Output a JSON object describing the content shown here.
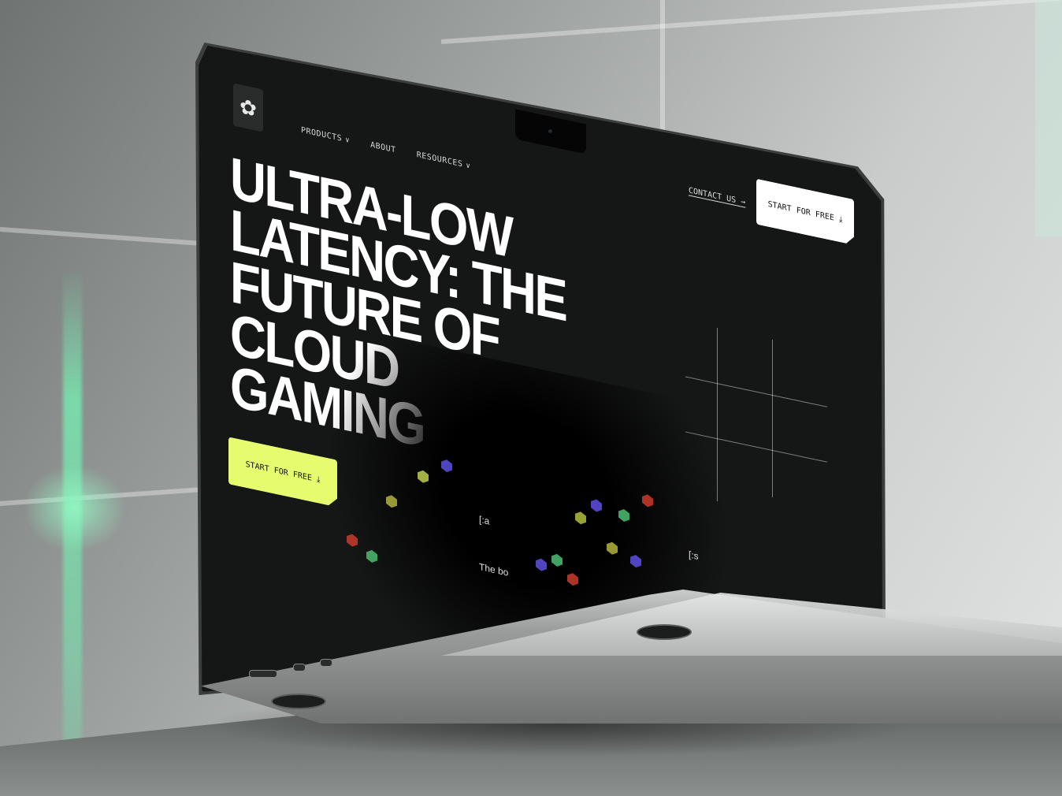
{
  "nav": {
    "items": [
      {
        "label": "PRODUCTS",
        "has_dropdown": true
      },
      {
        "label": "ABOUT",
        "has_dropdown": false
      },
      {
        "label": "RESOURCES",
        "has_dropdown": true
      }
    ]
  },
  "header": {
    "contact_label": "CONTACT US",
    "cta_label": "START FOR FREE"
  },
  "hero": {
    "title_lines": [
      "ULTRA-LOW",
      "LATENCY: THE",
      "FUTURE OF CLOUD",
      "GAMING"
    ],
    "cta_label": "START FOR FREE"
  },
  "content": {
    "fragment_1": "[:a",
    "fragment_2": "The bo",
    "fragment_3": "[:s"
  },
  "colors": {
    "accent_yellow": "#e6fb6e",
    "background": "#111111",
    "text": "#ffffff",
    "green_glow": "#78e6af"
  },
  "icons": {
    "logo": "brand-logo-icon",
    "dropdown": "chevron-down-icon",
    "arrow": "arrow-right-icon",
    "download": "download-arrow-icon"
  }
}
